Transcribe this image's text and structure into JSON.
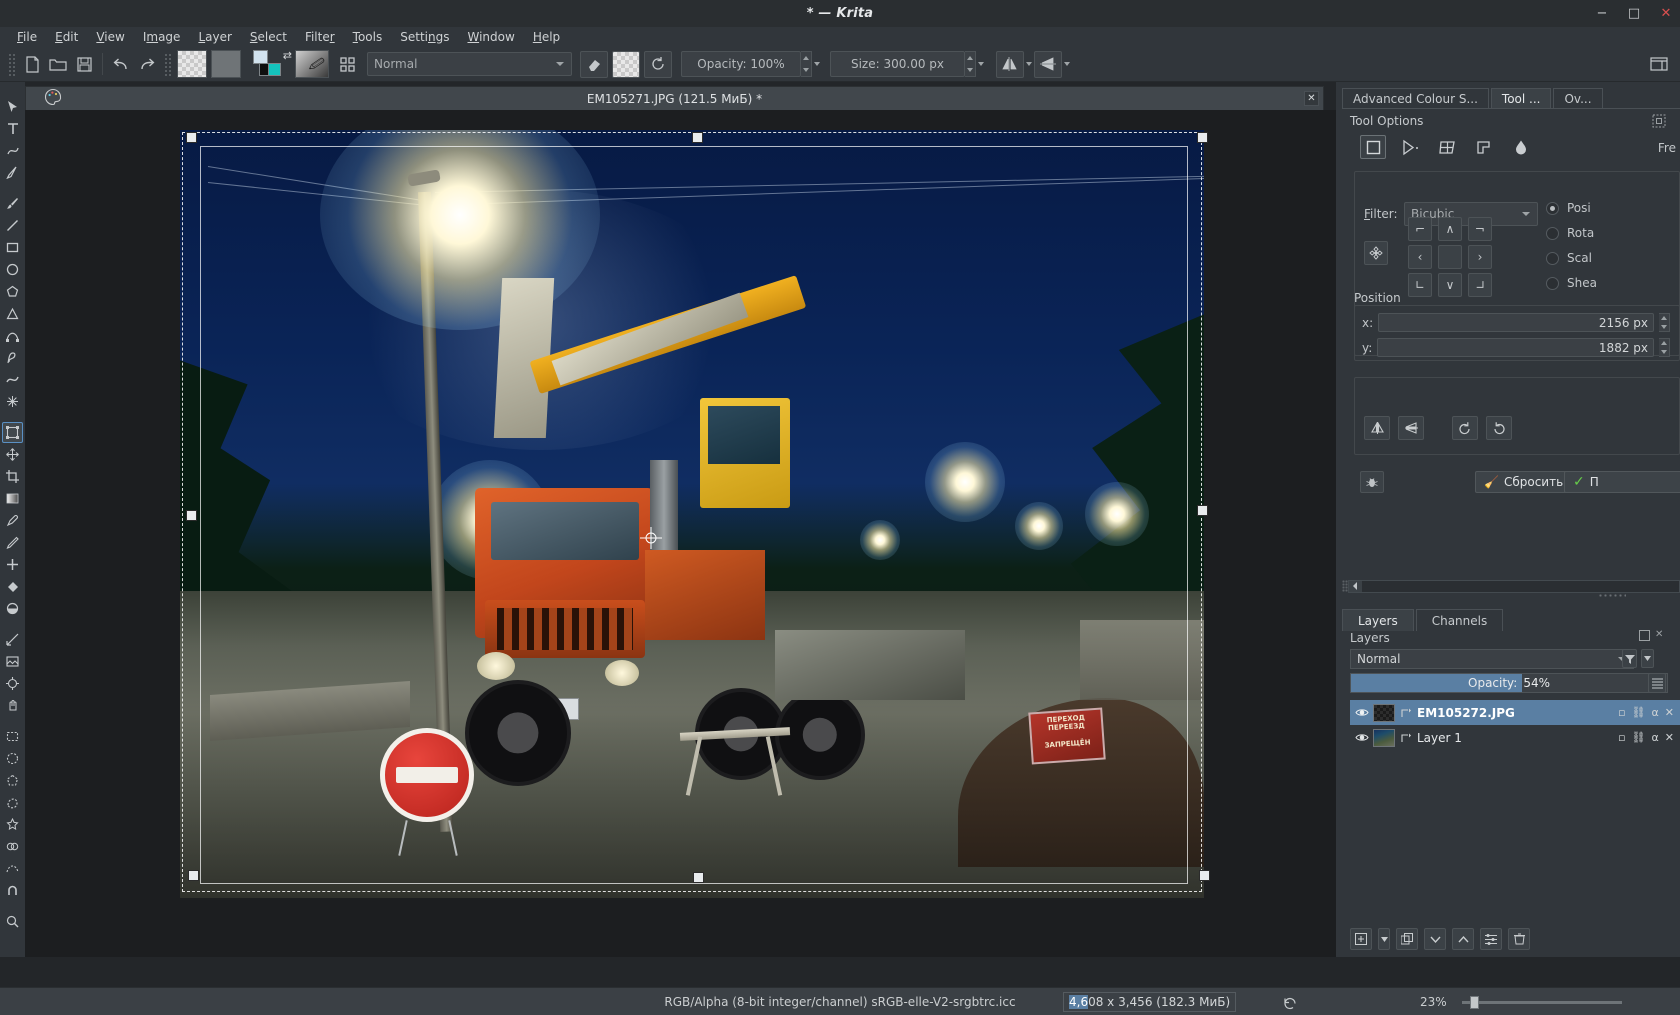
{
  "window": {
    "title": "* — Krita",
    "buttons": {
      "minimize": "−",
      "maximize": "□",
      "close": "✕"
    }
  },
  "menubar": {
    "items": [
      {
        "label": "File"
      },
      {
        "label": "Edit"
      },
      {
        "label": "View"
      },
      {
        "label": "Image"
      },
      {
        "label": "Layer"
      },
      {
        "label": "Select"
      },
      {
        "label": "Filter"
      },
      {
        "label": "Tools"
      },
      {
        "label": "Settings"
      },
      {
        "label": "Window"
      },
      {
        "label": "Help"
      }
    ]
  },
  "toolbar": {
    "blend_mode": "Normal",
    "opacity": "Opacity: 100%",
    "size": "Size: 300.00 px",
    "icons": {
      "new": "new-document-icon",
      "open": "open-folder-icon",
      "save": "save-icon",
      "undo": "undo-icon",
      "redo": "redo-icon",
      "eraser": "eraser-icon",
      "preserve_alpha": "preserve-alpha-icon",
      "reload": "reload-preset-icon",
      "mirror_h": "mirror-horizontal-icon",
      "mirror_v": "mirror-vertical-icon",
      "presets": "brush-presets-icon",
      "workspace": "workspace-chooser-icon"
    }
  },
  "toolbox": {
    "tools": [
      {
        "name": "shape-select-tool",
        "glyph": "◤"
      },
      {
        "name": "text-tool",
        "glyph": "T"
      },
      {
        "name": "edit-shapes-tool",
        "glyph": "❧"
      },
      {
        "name": "calligraphy-tool",
        "glyph": "✒"
      },
      {
        "name": "freehand-brush-tool",
        "glyph": "🖌"
      },
      {
        "name": "line-tool",
        "glyph": "╱"
      },
      {
        "name": "rectangle-tool",
        "glyph": "▭"
      },
      {
        "name": "ellipse-tool",
        "glyph": "◯"
      },
      {
        "name": "polygon-tool",
        "glyph": "⬠"
      },
      {
        "name": "polyline-tool",
        "glyph": "△"
      },
      {
        "name": "bezier-curve-tool",
        "glyph": "✧"
      },
      {
        "name": "freehand-path-tool",
        "glyph": "𝒻"
      },
      {
        "name": "dynamic-brush-tool",
        "glyph": "⌁"
      },
      {
        "name": "multibrush-tool",
        "glyph": "✸"
      },
      {
        "name": "transform-tool",
        "glyph": "⛶"
      },
      {
        "name": "move-tool",
        "glyph": "✥"
      },
      {
        "name": "crop-tool",
        "glyph": "⌗"
      },
      {
        "name": "gradient-tool",
        "glyph": "▥"
      },
      {
        "name": "colour-sampler-tool",
        "glyph": "⚲"
      },
      {
        "name": "colourize-mask-tool",
        "glyph": "✎"
      },
      {
        "name": "smart-patch-tool",
        "glyph": "✚"
      },
      {
        "name": "fill-tool",
        "glyph": "⬗"
      },
      {
        "name": "enclose-fill-tool",
        "glyph": "◒"
      },
      {
        "name": "measure-tool",
        "glyph": "📐"
      },
      {
        "name": "reference-images-tool",
        "glyph": "▦"
      },
      {
        "name": "assistant-tool",
        "glyph": "⌖"
      },
      {
        "name": "pan-tool",
        "glyph": "✋"
      },
      {
        "name": "rectangular-select-tool",
        "glyph": "⬚"
      },
      {
        "name": "elliptical-select-tool",
        "glyph": "⬭"
      },
      {
        "name": "polygonal-select-tool",
        "glyph": "⬡"
      },
      {
        "name": "freehand-select-tool",
        "glyph": "⌁"
      },
      {
        "name": "contiguous-select-tool",
        "glyph": "✦"
      },
      {
        "name": "similar-colour-select-tool",
        "glyph": "✧"
      },
      {
        "name": "bezier-select-tool",
        "glyph": "⌄"
      },
      {
        "name": "magnetic-select-tool",
        "glyph": "⚯"
      },
      {
        "name": "zoom-tool",
        "glyph": "🔍"
      }
    ],
    "active": "transform-tool"
  },
  "document": {
    "tab_label": "EM105271.JPG (121.5 МиБ) *",
    "close_label": "✕"
  },
  "dockers": {
    "tabs": [
      {
        "label": "Advanced Colour S...",
        "active": false
      },
      {
        "label": "Tool ...",
        "active": true
      },
      {
        "label": "Ov...",
        "active": false
      }
    ],
    "tool_options": {
      "title": "Tool Options",
      "float_icon": "float-docker-icon",
      "mode_icons": [
        {
          "name": "free-transform-mode-icon",
          "glyph": "□",
          "active": true
        },
        {
          "name": "perspective-transform-mode-icon",
          "glyph": "▷",
          "active": false
        },
        {
          "name": "warp-transform-mode-icon",
          "glyph": "⧉",
          "active": false
        },
        {
          "name": "cage-transform-mode-icon",
          "glyph": "⌓",
          "active": false
        },
        {
          "name": "liquify-transform-mode-icon",
          "glyph": "💧",
          "active": false
        }
      ],
      "free_label": "Fre",
      "filter_label": "Filter:",
      "filter_value": "Bicubic",
      "anchor_icon": "anchor-point-icon",
      "anchors": [
        "⌐",
        "∧",
        "¬",
        "<",
        "",
        "›",
        "∟",
        "∨",
        "⌐"
      ],
      "radios": [
        {
          "label": "Posi",
          "selected": true,
          "name": "position-radio"
        },
        {
          "label": "Rota",
          "selected": false,
          "name": "rotation-radio"
        },
        {
          "label": "Scal",
          "selected": false,
          "name": "scale-radio"
        },
        {
          "label": "Shea",
          "selected": false,
          "name": "shear-radio"
        }
      ],
      "position_title": "Position",
      "x_label": "x:",
      "x_value": "2156 px",
      "y_label": "y:",
      "y_value": "1882 px",
      "flip_buttons": [
        {
          "name": "flip-horizontal-button",
          "glyph": "◁▷"
        },
        {
          "name": "flip-vertical-button",
          "glyph": "≜"
        },
        {
          "name": "rotate-ccw-button",
          "glyph": "↺"
        },
        {
          "name": "rotate-cw-button",
          "glyph": "↻"
        }
      ],
      "bug_button": "bug-report-button",
      "reset_label": "Сбросить",
      "reset_icon": "broom-icon",
      "apply_icon": "check-icon",
      "apply_label": "П"
    },
    "layers": {
      "tabs": [
        {
          "label": "Layers",
          "active": true
        },
        {
          "label": "Channels",
          "active": false
        }
      ],
      "panel_title": "Layers",
      "blend_mode": "Normal",
      "opacity_label": "Opacity:",
      "opacity_value": "54%",
      "opacity_percent": 54,
      "rows": [
        {
          "name": "EM105272.JPG",
          "selected": true,
          "thumb": "transparent-checker",
          "visible": true,
          "props": [
            "⊡",
            "⛓",
            "α",
            "✕"
          ]
        },
        {
          "name": "Layer 1",
          "selected": false,
          "thumb": "photo-thumbnail",
          "visible": true,
          "props": [
            "⊡",
            "⛓",
            "α",
            "✕"
          ]
        }
      ],
      "buttons": [
        {
          "name": "add-layer-button",
          "glyph": "⊞"
        },
        {
          "name": "add-layer-dropdown",
          "glyph": "▾"
        },
        {
          "name": "duplicate-layer-button",
          "glyph": "⧉"
        },
        {
          "name": "move-layer-down-button",
          "glyph": "∨"
        },
        {
          "name": "move-layer-up-button",
          "glyph": "∧"
        },
        {
          "name": "layer-properties-button",
          "glyph": "≡"
        },
        {
          "name": "delete-layer-button",
          "glyph": "🗑"
        }
      ]
    }
  },
  "statusbar": {
    "colour_space": "RGB/Alpha (8-bit integer/channel)  sRGB-elle-V2-srgbtrc.icc",
    "dimensions_selected": "4,6",
    "dimensions_rest": "08 x 3,456 (182.3 МиБ)",
    "history_icon": "undo-history-icon",
    "zoom": "23%"
  },
  "colors": {
    "window_bg": "#31363b",
    "titlebar_bg": "#2a2e31",
    "canvas_bg": "#1c1e20",
    "accent_blue": "#5a7fa3",
    "text": "#c8cbcd",
    "fg_swatch": "#d2e3ef",
    "bg_swatch": "#14c3bd"
  }
}
